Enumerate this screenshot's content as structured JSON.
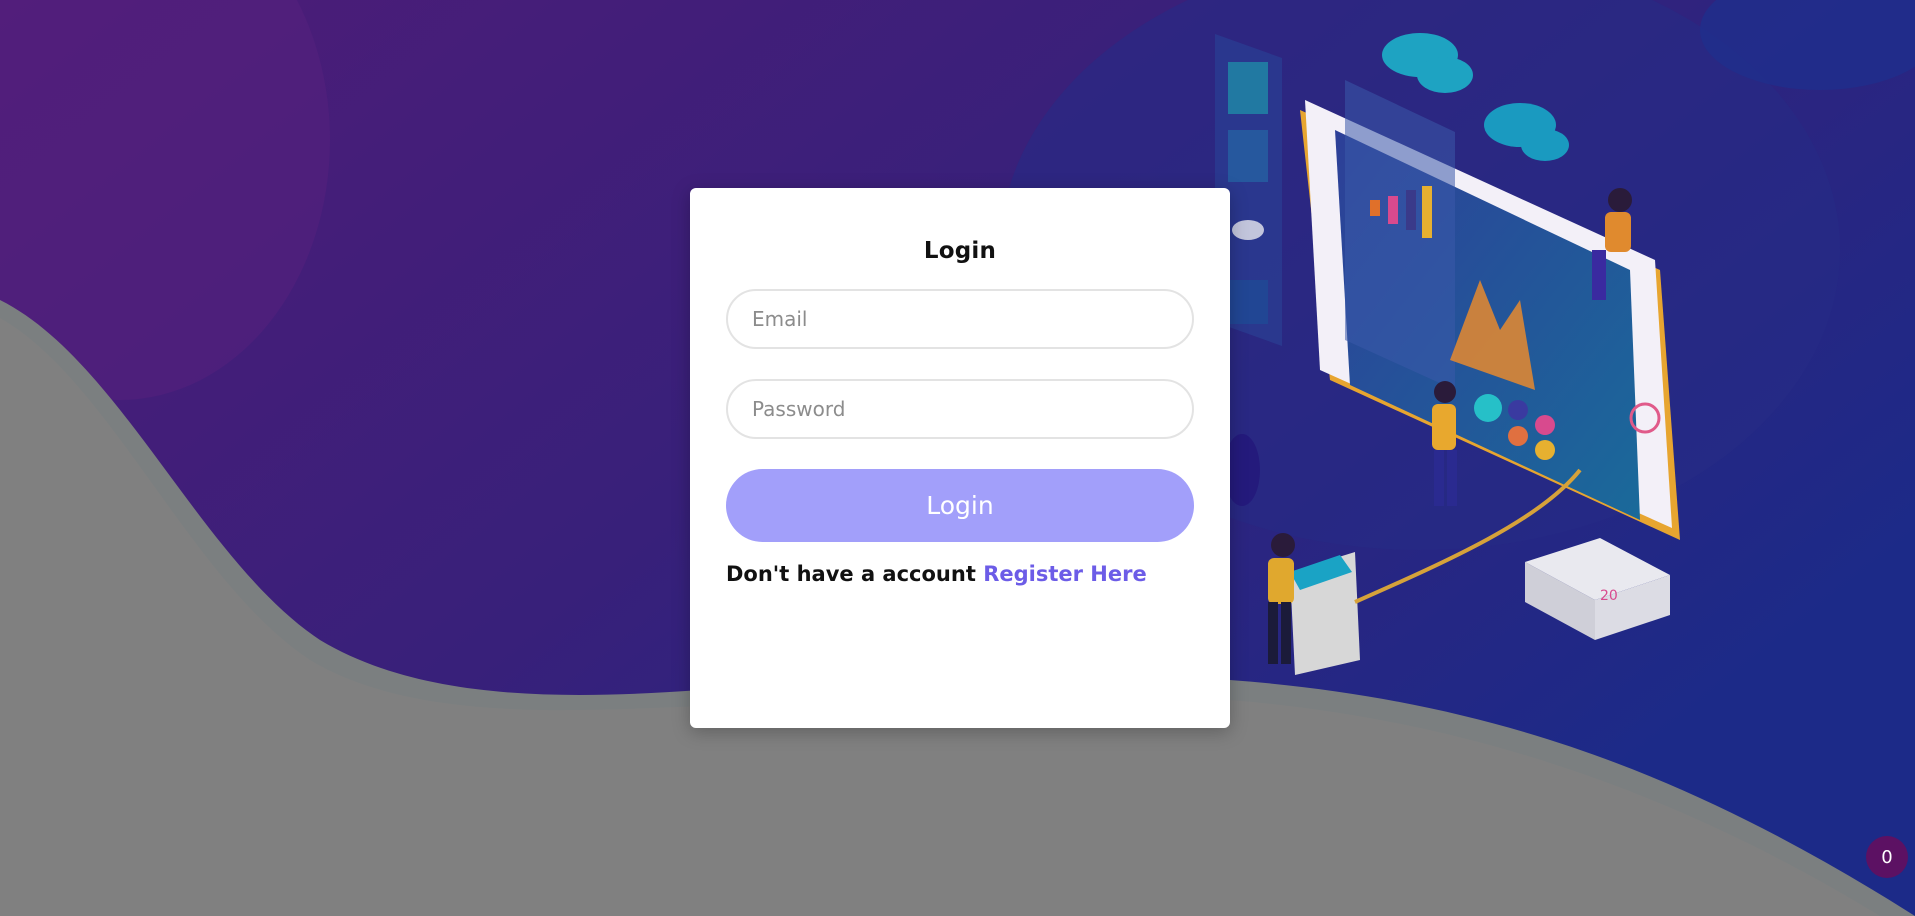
{
  "login_form": {
    "title": "Login",
    "email_placeholder": "Email",
    "email_value": "",
    "password_placeholder": "Password",
    "password_value": "",
    "submit_label": "Login",
    "register_prompt": "Don't have a account",
    "register_link_label": "Register Here"
  },
  "notification_badge": {
    "count": "0"
  },
  "colors": {
    "background_gradient_start": "#4a1a78",
    "background_gradient_end": "#1c2a88",
    "wave_gray": "#808080",
    "button": "#a29ffa",
    "link": "#6c5ce7",
    "badge": "#5c1163"
  },
  "illustration": {
    "subject": "isometric analytics dashboard on a giant smartphone with people, clouds and calendar"
  }
}
